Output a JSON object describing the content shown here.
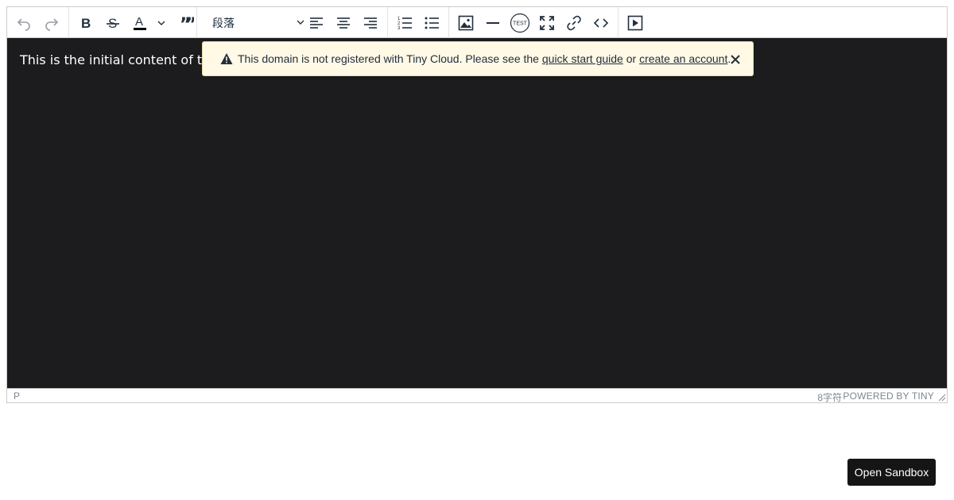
{
  "toolbar": {
    "block_format_value": "段落",
    "buttons": [
      "undo-icon",
      "redo-icon",
      "bold-icon",
      "strikethrough-icon",
      "text-color-icon",
      "blockquote-icon",
      "align-left-icon",
      "align-center-icon",
      "align-right-icon",
      "ordered-list-icon",
      "unordered-list-icon",
      "image-icon",
      "horizontal-rule-icon",
      "test-icon",
      "fullscreen-icon",
      "link-icon",
      "code-icon",
      "preview-icon"
    ],
    "test_label": "TEST"
  },
  "content": {
    "paragraph": "This is the initial content of the"
  },
  "notice": {
    "text_before": "This domain is not registered with Tiny Cloud. Please see the",
    "link1": "quick start guide",
    "text_middle": "or",
    "link2": "create an account",
    "text_after": "."
  },
  "statusbar": {
    "path": "P",
    "count": "8字符",
    "brand": "POWERED BY TINY"
  },
  "sandbox_button": "Open Sandbox",
  "colors": {
    "content_bg": "#1c1c1e",
    "notice_bg": "#fff9e6",
    "icon": "#222f3e"
  }
}
